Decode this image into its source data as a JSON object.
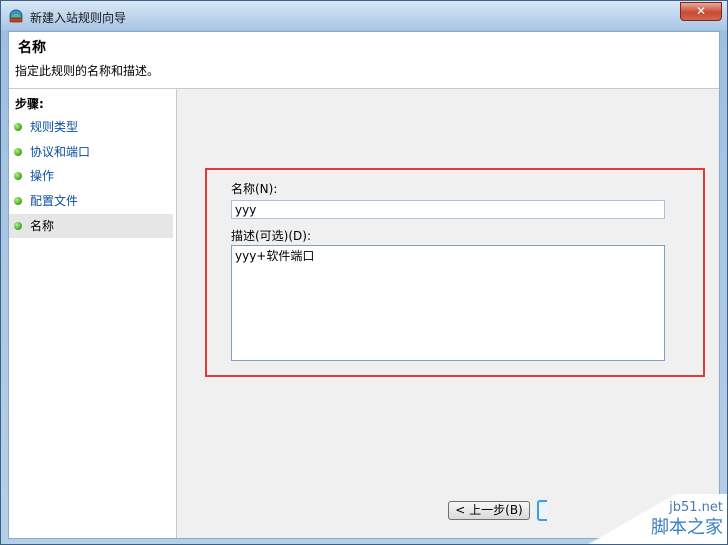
{
  "window": {
    "title": "新建入站规则向导",
    "close_label": "✕"
  },
  "header": {
    "title": "名称",
    "subtitle": "指定此规则的名称和描述。"
  },
  "steps": {
    "title": "步骤:",
    "items": [
      {
        "label": "规则类型"
      },
      {
        "label": "协议和端口"
      },
      {
        "label": "操作"
      },
      {
        "label": "配置文件"
      },
      {
        "label": "名称"
      }
    ]
  },
  "form": {
    "name_label": "名称(N):",
    "name_value": "yyy",
    "description_label": "描述(可选)(D):",
    "description_value": "yyy+软件端口"
  },
  "buttons": {
    "back_label": "< 上一步(B)"
  },
  "watermark": {
    "line1": "jb51.net",
    "line2": "脚本之家"
  },
  "colors": {
    "highlight_border": "#e03b3b",
    "link": "#0a4ea3",
    "step_bullet": "#3aa51a"
  }
}
